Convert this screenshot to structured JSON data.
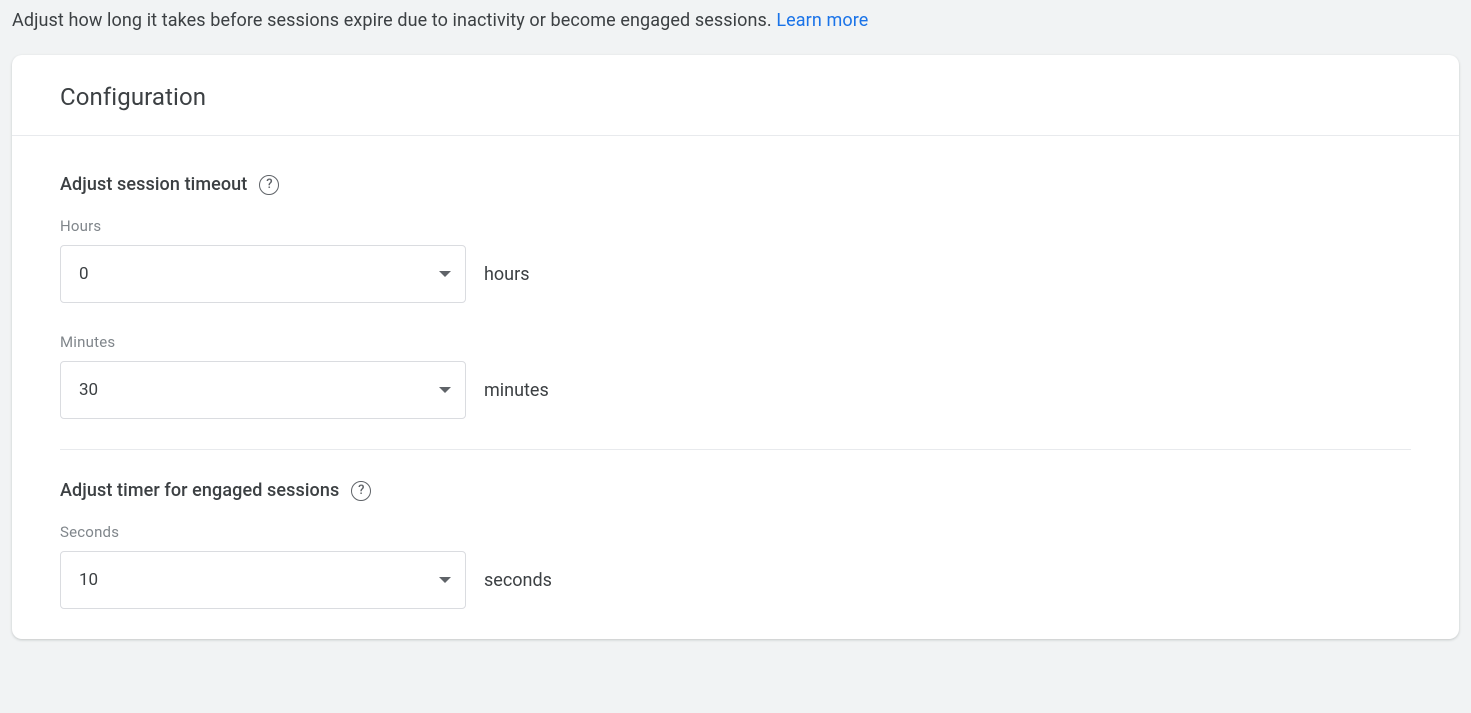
{
  "header": {
    "description": "Adjust how long it takes before sessions expire due to inactivity or become engaged sessions. ",
    "learn_more": "Learn more"
  },
  "card": {
    "title": "Configuration",
    "session_timeout": {
      "heading": "Adjust session timeout",
      "hours_label": "Hours",
      "hours_value": "0",
      "hours_suffix": "hours",
      "minutes_label": "Minutes",
      "minutes_value": "30",
      "minutes_suffix": "minutes"
    },
    "engaged_sessions": {
      "heading": "Adjust timer for engaged sessions",
      "seconds_label": "Seconds",
      "seconds_value": "10",
      "seconds_suffix": "seconds"
    }
  }
}
